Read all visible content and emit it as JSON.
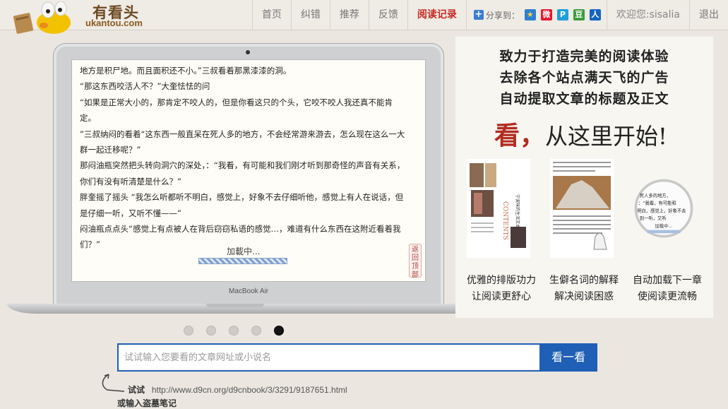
{
  "logo": {
    "cn": "有看头",
    "en": "ukantou.com"
  },
  "nav": {
    "items": [
      "首页",
      "纠错",
      "推荐",
      "反馈",
      "阅读记录"
    ],
    "share_label": "分享到：",
    "share_icons": [
      "qzone-icon",
      "weibo-icon",
      "tencent-weibo-icon",
      "douban-icon",
      "renren-icon"
    ],
    "share_glyphs": [
      "★",
      "微",
      "P",
      "豆",
      "人"
    ],
    "welcome": "欢迎您:sisalia",
    "logout": "退出"
  },
  "laptop": {
    "paragraphs": [
      "地方是积尸地。而且面积还不小。”三叔看着那黑漆漆的洞。",
      "“那这东西咬活人不？”大奎怯怯的问",
      "“如果是正常大小的，那肯定不咬人的，但是你看这只的个头，它咬不咬人我还真不能肯定。",
      "”三叔纳闷的看着“这东西一般直呆在死人多的地方，不会经常游来游去，怎么现在这么一大群一起迁移呢？”",
      "那闷油瓶突然把头转向洞穴的深处，：“我看，有可能和我们刚才听到那奇怪的声音有关系，你们有没有听清楚是什么？”",
      "胖奎摇了摇头 “我怎么听都听不明白，感觉上，好象不去仔细听他，感觉上有人在说话，但是仔细一听，又听不懂——”",
      "闷油瓶点点头“感觉上有点被人在背后窃窃私语的感觉…，难道有什么东西在这附近看着我们？”"
    ],
    "loading": "加載中...",
    "back_top": "返回顶部",
    "brand": "MacBook Air"
  },
  "carousel": {
    "count": 5,
    "active_index": 4
  },
  "panel": {
    "slogans": [
      "致力于打造完美的阅读体验",
      "去除各个站点满天飞的广告",
      "自动提取文章的标题及正文"
    ],
    "start_kan": "看，",
    "start_rest": "从这里开始!",
    "features": [
      {
        "line1": "优雅的排版功力",
        "line2": "让阅读更舒心"
      },
      {
        "line1": "生僻名词的解释",
        "line2": "解决阅读困惑"
      },
      {
        "line1": "自动加载下一章",
        "line2": "使阅读更流畅"
      }
    ],
    "thumb_texts": {
      "contents": "CONTENTS",
      "book_title": "宁波味的生活文本",
      "magnifier_lines": [
        "死人多的地方，",
        "：“我看，有可能和",
        "明白，感觉上，好象不去",
        "到一听，又听"
      ],
      "magnifier_loading": "加载中..."
    }
  },
  "search": {
    "placeholder": "试试输入您要看的文章网址或小说名",
    "button": "看一看"
  },
  "hints": {
    "try_label": "试试",
    "example_url": "http://www.d9cn.org/d9cnbook/3/3291/9187651.html",
    "or_label": "或输入盗墓笔记"
  }
}
